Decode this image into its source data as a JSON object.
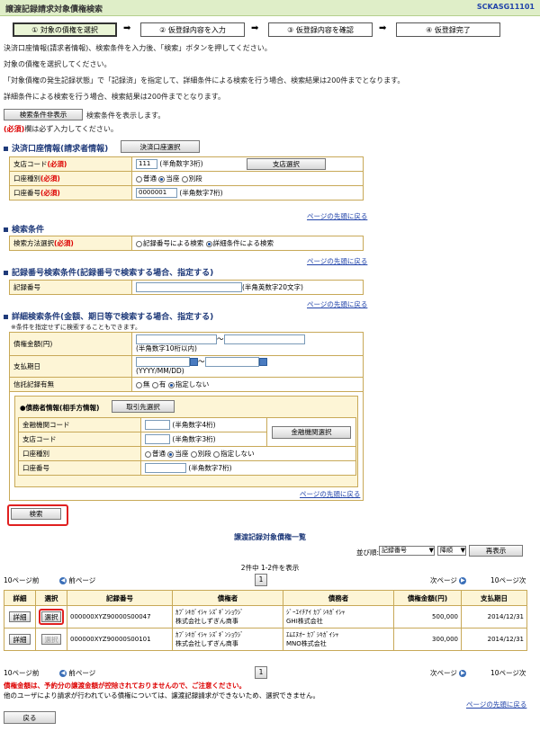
{
  "header": {
    "title": "譲渡記録請求対象債権検索",
    "code": "SCKASG11101"
  },
  "steps": [
    "① 対象の債権を選択",
    "② 仮登録内容を入力",
    "③ 仮登録内容を確認",
    "④ 仮登録完了"
  ],
  "messages": [
    "決済口座情報(請求者情報)、検索条件を入力後、「検索」ボタンを押してください。",
    "対象の債権を選択してください。",
    "「対象債権の発生記録状態」で「記録済」を指定して、詳細条件による検索を行う場合、検索結果は200件までとなります。",
    "詳細条件による検索を行う場合、検索結果は200件までとなります。"
  ],
  "toggle": {
    "button": "検索条件非表示",
    "text": "検索条件を表示します。"
  },
  "required_note": {
    "mark": "(必須)",
    "text": "欄は必ず入力してください。"
  },
  "settlement": {
    "title": "決済口座情報(請求者情報)",
    "select_button": "決済口座選択",
    "branch_label": "支店コード",
    "branch_value": "111",
    "branch_hint": "(半角数字3桁)",
    "branch_button": "支店選択",
    "account_type_label": "口座種別",
    "account_type_options": [
      "普通",
      "当座",
      "別段"
    ],
    "account_no_label": "口座番号",
    "account_no_value": "0000001",
    "account_no_hint": "(半角数字7桁)"
  },
  "required": "(必須)",
  "page_top_link": "ページの先頭に戻る",
  "search_cond": {
    "title": "検索条件",
    "method_label": "検索方法選択",
    "options": [
      "記録番号による検索",
      "詳細条件による検索"
    ]
  },
  "record_search": {
    "title": "記録番号検索条件(記録番号で検索する場合、指定する)",
    "label": "記録番号",
    "hint": "(半角英数字20文字)"
  },
  "detail_search": {
    "title": "詳細検索条件(金額、期日等で検索する場合、指定する)",
    "note": "※条件を指定せずに検索することもできます。",
    "amount_label": "債権金額(円)",
    "amount_tilde": "〜",
    "amount_hint": "(半角数字10桁以内)",
    "due_label": "支払期日",
    "due_tilde": "〜",
    "due_hint": "(YYYY/MM/DD)",
    "trust_label": "信託記録有無",
    "trust_options": [
      "無",
      "有",
      "指定しない"
    ],
    "debtor_title": "●債務者情報(相手方情報)",
    "partner_button": "取引先選択",
    "bank_label": "金融機関コード",
    "bank_hint": "(半角数字4桁)",
    "branch_label": "支店コード",
    "branch_hint": "(半角数字3桁)",
    "bank_select_button": "金融機関選択",
    "acct_type_label": "口座種別",
    "acct_type_options": [
      "普通",
      "当座",
      "別段",
      "指定しない"
    ],
    "acct_no_label": "口座番号",
    "acct_no_hint": "(半角数字7桁)"
  },
  "search_button": "検索",
  "results": {
    "title": "譲渡記録対象債権一覧",
    "sort_label": "並び順:",
    "sort_value": "記録番号",
    "order_value": "降順",
    "redisplay_button": "再表示",
    "count_text": "2件中 1-2件を表示",
    "prev10": "10ページ前",
    "prev": "前ページ",
    "page": "1",
    "next": "次ページ",
    "next10": "10ページ次",
    "headers": [
      "詳細",
      "選択",
      "記録番号",
      "債権者",
      "債務者",
      "債権金額(円)",
      "支払期日"
    ],
    "detail_button": "詳細",
    "select_button": "選択",
    "rows": [
      {
        "no": "000000XYZ90000S00047",
        "creditor1": "ｶﾌﾞｼｷｶﾞｲｼｬ ｼｽﾞｷﾞﾝｼｮｳｼﾞ",
        "creditor2": "株式会社しずぎん商事",
        "debtor1": "ｼﾞｰｴｲﾁｱｲ ｶﾌﾞｼｷｶﾞｲｼｬ",
        "debtor2": "GHI株式会社",
        "amount": "500,000",
        "due": "2014/12/31"
      },
      {
        "no": "000000XYZ90000S00101",
        "creditor1": "ｶﾌﾞｼｷｶﾞｲｼｬ ｼｽﾞｷﾞﾝｼｮｳｼﾞ",
        "creditor2": "株式会社しずぎん商事",
        "debtor1": "ｴﾑｴﾇｵｰ ｶﾌﾞｼｷｶﾞｲｼｬ",
        "debtor2": "MNO株式会社",
        "amount": "300,000",
        "due": "2014/12/31"
      }
    ],
    "warning": "債権金額は、予約分の譲渡金額が控除されておりませんので、ご注意ください。",
    "note": "他のユーザにより請求が行われている債権については、譲渡記録請求ができないため、選択できません。"
  },
  "back_button": "戻る"
}
